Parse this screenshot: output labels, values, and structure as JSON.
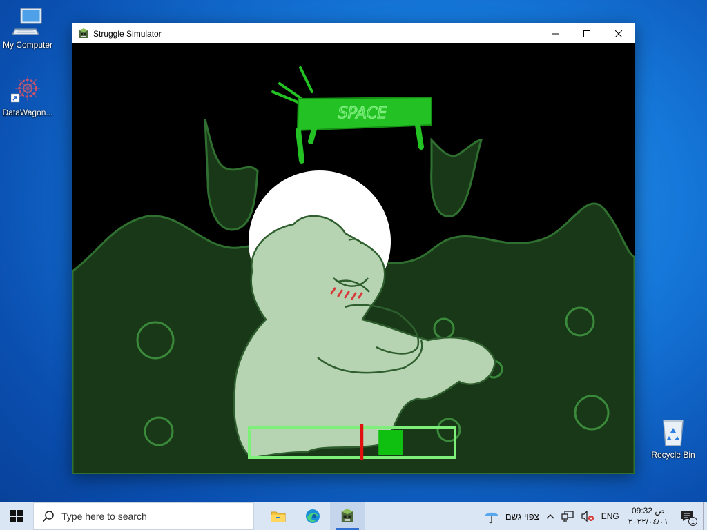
{
  "desktop": {
    "icons": [
      {
        "label": "My Computer",
        "icon": "computer-icon"
      },
      {
        "label": "DataWagon...",
        "icon": "datawagon-icon"
      },
      {
        "label": "Recycle Bin",
        "icon": "recycle-bin-icon"
      }
    ]
  },
  "window": {
    "title": "Struggle Simulator",
    "icon": "game-app-icon",
    "controls": [
      "minimize",
      "maximize",
      "close"
    ]
  },
  "game": {
    "prompt_key_text": "SPACE",
    "progress": {
      "marker_position": 0.545,
      "target_zone_start": 0.63,
      "target_zone_end": 0.75,
      "colors": {
        "frame": "#7ef07a",
        "marker": "#e01010",
        "target": "#10c010"
      }
    }
  },
  "taskbar": {
    "search_placeholder": "Type here to search",
    "pinned": [
      "file-explorer-icon",
      "edge-icon",
      "game-app-icon"
    ],
    "weather_text": "צפוי גשם",
    "language": "ENG",
    "clock_time": "09:32 ص",
    "clock_date": "٢٠٢٢/٠٤/٠١",
    "notification_count": "1"
  },
  "colors": {
    "taskbar_bg": "#dbe6f4",
    "desktop_bg": "#1577d9",
    "slime_bg": "#183818",
    "blob_fill": "#b7d4b2"
  }
}
